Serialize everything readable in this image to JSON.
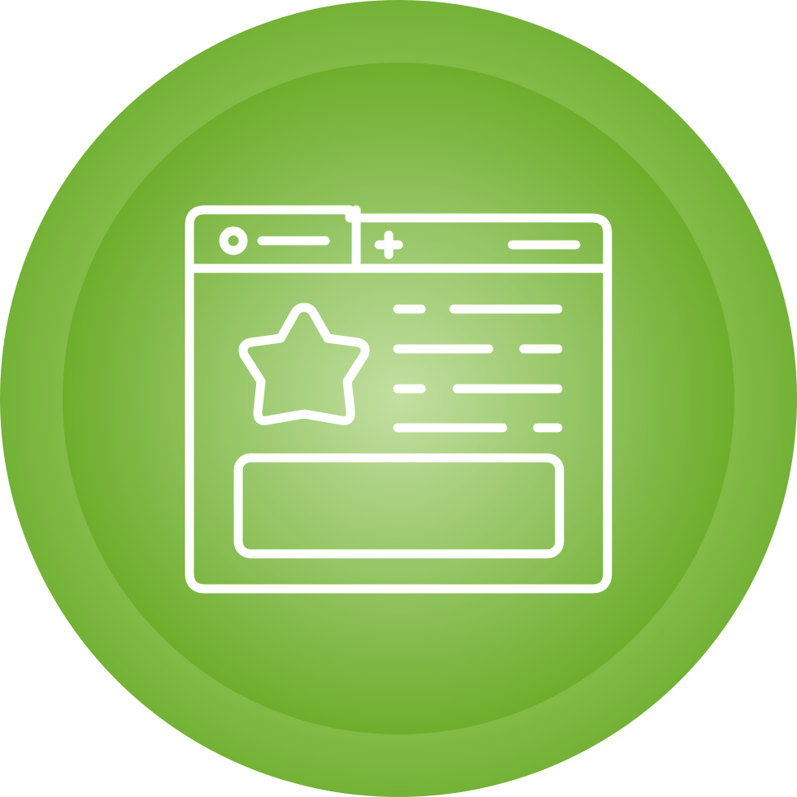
{
  "icon": {
    "name": "favorite-webpage-icon",
    "description_name": "browser-window-with-star",
    "colors": {
      "outer_ring": "#7fb843",
      "inner_center": "#c2dea0",
      "inner_edge": "#6fae2d",
      "stroke": "#ffffff"
    },
    "parts": [
      "browser-window-icon",
      "active-tab-icon",
      "record-dot-icon",
      "new-tab-plus-icon",
      "star-icon",
      "text-lines-icon",
      "button-bar-icon"
    ]
  }
}
